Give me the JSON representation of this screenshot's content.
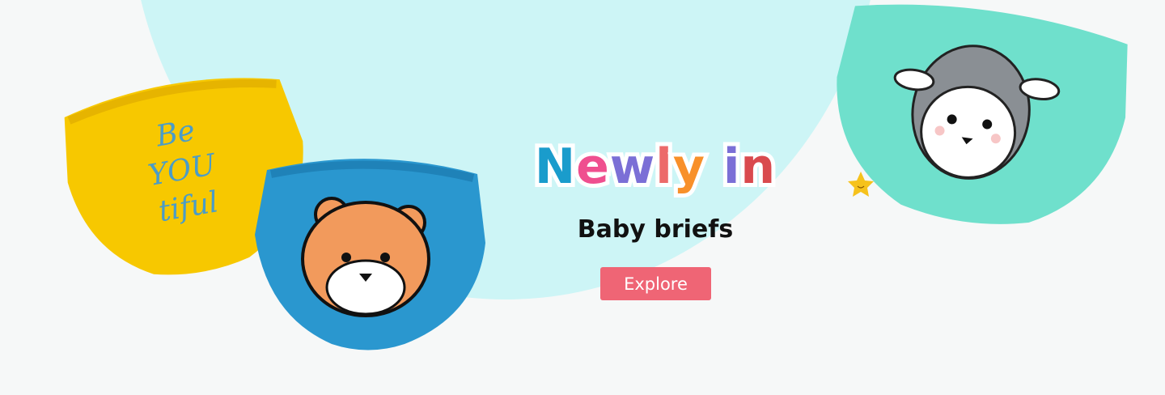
{
  "banner": {
    "headline_letters": [
      {
        "char": "N",
        "color": "#1a9ccc"
      },
      {
        "char": "e",
        "color": "#ef4f8f"
      },
      {
        "char": "w",
        "color": "#7b6fd6"
      },
      {
        "char": "l",
        "color": "#ec6a6a"
      },
      {
        "char": "y",
        "color": "#f8902a"
      },
      {
        "char": " ",
        "color": "#ffffff"
      },
      {
        "char": "i",
        "color": "#7b6fd6"
      },
      {
        "char": "n",
        "color": "#d94a4e"
      }
    ],
    "subtitle": "Baby briefs",
    "cta_label": "Explore",
    "cta_color": "#ef6575",
    "background_circle_color": "#cdf5f6",
    "products": [
      {
        "name": "yellow-brief",
        "color": "#f7c800",
        "print_text": "Be YOU tiful"
      },
      {
        "name": "blue-tiger-brief",
        "color": "#2a97cf"
      },
      {
        "name": "mint-sheep-brief",
        "color": "#6fe0cc"
      }
    ],
    "decoration": "star-icon"
  }
}
